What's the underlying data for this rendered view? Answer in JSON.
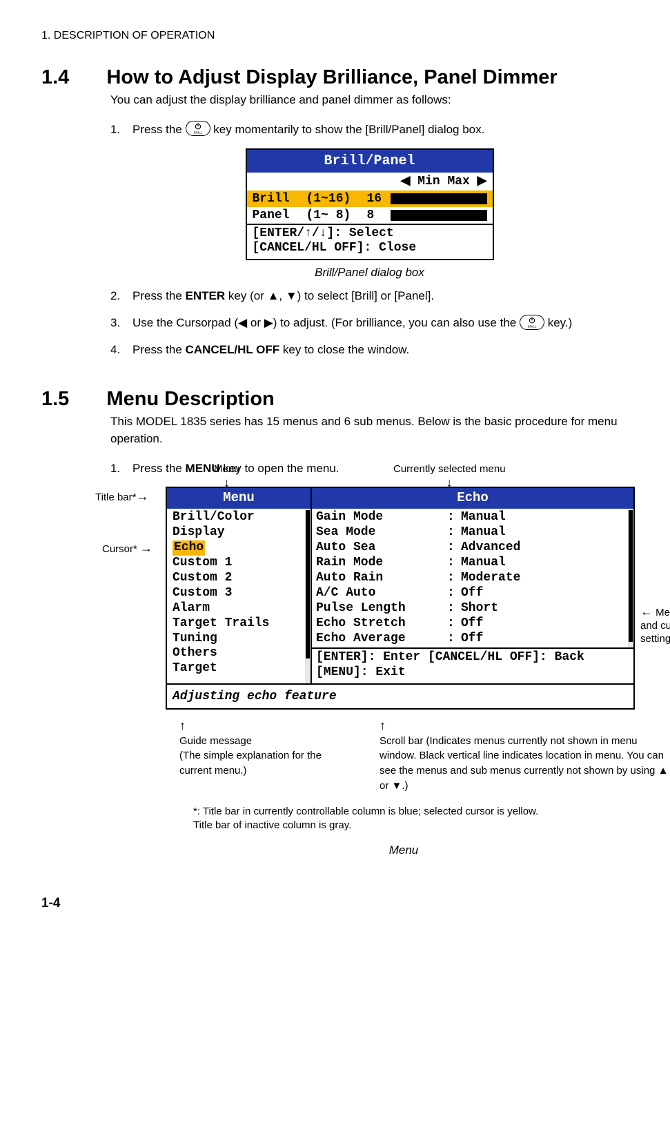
{
  "chapter_header": "1.  DESCRIPTION OF OPERATION",
  "s14": {
    "num": "1.4",
    "title": "How to Adjust Display Brilliance, Panel Dimmer",
    "intro": "You can adjust the display brilliance and panel dimmer as follows:",
    "step1_a": "Press the",
    "step1_b": "key momentarily to show the [Brill/Panel] dialog box.",
    "dialog": {
      "title": "Brill/Panel",
      "minmax": "◀ Min   Max ▶",
      "row1_lbl": "Brill",
      "row1_rng": "(1~16)",
      "row1_val": "16",
      "row2_lbl": "Panel",
      "row2_rng": "(1~ 8)",
      "row2_val": "8",
      "help1": "[ENTER/↑/↓]: Select",
      "help2": "[CANCEL/HL OFF]: Close"
    },
    "caption": "Brill/Panel dialog box",
    "step2_a": "Press the ",
    "step2_b": "ENTER",
    "step2_c": " key (or ▲, ▼) to select [Brill] or [Panel].",
    "step3_a": "Use the Cursorpad (◀ or ▶) to adjust. (For brilliance, you can also use the",
    "step3_b": "key.)",
    "step4_a": "Press the ",
    "step4_b": "CANCEL/HL OFF",
    "step4_c": " key to close the window."
  },
  "s15": {
    "num": "1.5",
    "title": "Menu Description",
    "intro": "This MODEL 1835 series has 15 menus and 6 sub menus. Below is the basic procedure for menu operation.",
    "step1_a": "Press the ",
    "step1_b": "MENU",
    "step1_c": " key to open the menu.",
    "anno_menu": "Menu",
    "anno_curr": "Currently selected menu",
    "anno_titlebar": "Title bar*",
    "anno_cursor": "Cursor*",
    "anno_items": "Menu items and current settings",
    "menu": {
      "left_head": "Menu",
      "right_head": "Echo",
      "items": [
        "Brill/Color",
        "Display",
        "Echo",
        "Custom 1",
        "Custom 2",
        "Custom 3",
        "Alarm",
        "Target Trails",
        "Tuning",
        "Others",
        "Target"
      ],
      "settings": [
        {
          "k": "Gain Mode",
          "v": "Manual"
        },
        {
          "k": "Sea Mode",
          "v": "Manual"
        },
        {
          "k": "Auto Sea",
          "v": "Advanced"
        },
        {
          "k": "Rain Mode",
          "v": "Manual"
        },
        {
          "k": "Auto Rain",
          "v": "Moderate"
        },
        {
          "k": "A/C Auto",
          "v": "Off"
        },
        {
          "k": "Pulse Length",
          "v": "Short"
        },
        {
          "k": "Echo Stretch",
          "v": "Off"
        },
        {
          "k": "Echo Average",
          "v": "Off"
        }
      ],
      "back1": "[ENTER]: Enter [CANCEL/HL OFF]: Back",
      "back2": "[MENU]: Exit",
      "guide": "Adjusting echo feature"
    },
    "call_guide_h": "Guide message",
    "call_guide_b": "(The simple explanation for  the current menu.)",
    "call_scroll": "Scroll bar (Indicates menus currently not shown in menu window. Black vertical line indicates location in menu. You can see the menus and sub menus currently not shown by using ▲ or ▼.)",
    "footnote1": "*: Title bar in currently controllable column is blue; selected cursor is yellow.",
    "footnote2": "    Title bar of inactive column is gray.",
    "caption": "Menu"
  },
  "page": "1-4"
}
